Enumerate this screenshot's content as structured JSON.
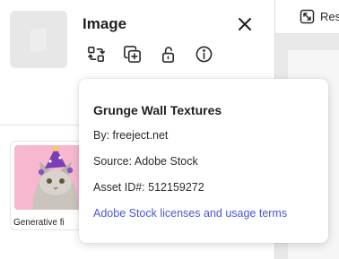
{
  "panel": {
    "title": "Image",
    "icons": [
      "replace-icon",
      "duplicate-icon",
      "unlock-icon",
      "info-icon"
    ],
    "close_icon": "close-icon"
  },
  "toolbar": {
    "resize_label": "Res"
  },
  "results": {
    "items": [
      {
        "label": "Generative fi"
      }
    ]
  },
  "popover": {
    "title": "Grunge Wall Textures",
    "by": "By: freeject.net",
    "source": "Source: Adobe Stock",
    "asset_id": "Asset ID#: 512159272",
    "link": "Adobe Stock licenses and usage terms"
  },
  "colors": {
    "link": "#4b55d6",
    "thumb_bg": "#f7b8cf"
  }
}
